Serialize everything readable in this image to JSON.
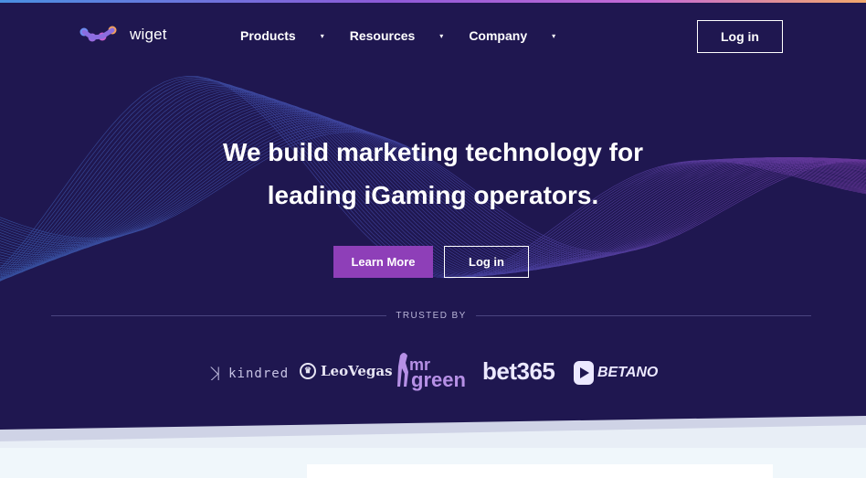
{
  "brand": {
    "name": "wiget"
  },
  "nav": {
    "items": [
      {
        "label": "Products",
        "caret": "▾"
      },
      {
        "label": "Resources",
        "caret": "▾"
      },
      {
        "label": "Company",
        "caret": "▾"
      }
    ],
    "login_label": "Log in"
  },
  "hero": {
    "headline_line1": "We build marketing technology for",
    "headline_line2": "leading iGaming operators.",
    "learn_more_label": "Learn More",
    "login_label": "Log in"
  },
  "trusted": {
    "label": "TRUSTED BY",
    "logos": {
      "kindred": "kindred",
      "leovegas": "LeoVegas",
      "mrgreen_a": "mr",
      "mrgreen_b": "green",
      "bet365": "bet365",
      "betano": "BETANO"
    }
  },
  "colors": {
    "hero_bg": "#1f1750",
    "accent_purple": "#8e3fb8",
    "logo_dots": [
      "#6d8df0",
      "#9b6be0",
      "#c95fd0",
      "#f2a05e"
    ]
  }
}
